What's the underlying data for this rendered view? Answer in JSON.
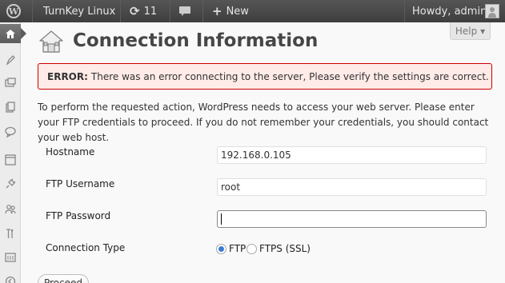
{
  "adminbar": {
    "site_name": "TurnKey Linux",
    "updates_count": "11",
    "new_label": "New",
    "howdy": "Howdy, admin"
  },
  "help_tab": {
    "label": "Help",
    "arrow": "▾"
  },
  "page": {
    "title": "Connection Information"
  },
  "error": {
    "prefix": "ERROR:",
    "message": "There was an error connecting to the server, Please verify the settings are correct."
  },
  "intro": "To perform the requested action, WordPress needs to access your web server. Please enter your FTP credentials to proceed. If you do not remember your credentials, you should contact your web host.",
  "form": {
    "hostname_label": "Hostname",
    "hostname_value": "192.168.0.105",
    "username_label": "FTP Username",
    "username_value": "root",
    "password_label": "FTP Password",
    "password_value": "",
    "conn_type_label": "Connection Type",
    "options": [
      "FTP",
      "FTPS (SSL)"
    ],
    "selected_option": "FTP",
    "proceed_label": "Proceed"
  },
  "menu_icons": [
    "dashboard-icon",
    "posts-icon",
    "media-icon",
    "pages-icon",
    "comments-icon",
    "appearance-icon",
    "plugins-icon",
    "users-icon",
    "tools-icon",
    "settings-icon",
    "collapse-icon"
  ],
  "colors": {
    "adminbar": "#464646",
    "error_border": "#cc0000",
    "error_bg": "#ffebe8",
    "radio_selected": "#3a7bd5"
  }
}
